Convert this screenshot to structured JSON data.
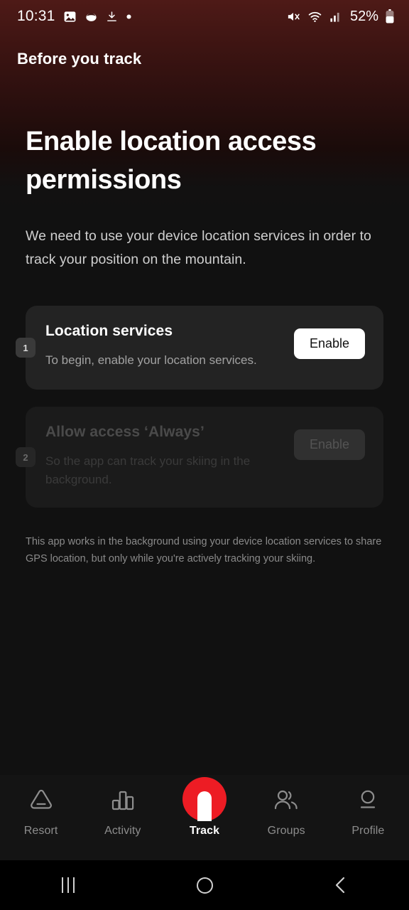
{
  "status_bar": {
    "time": "10:31",
    "battery_text": "52%",
    "icons": [
      "image-icon",
      "app-icon",
      "download-icon",
      "dot-icon",
      "mute-icon",
      "wifi-icon",
      "signal-icon",
      "battery-icon"
    ]
  },
  "top_bar": {
    "title": "Before you track"
  },
  "main": {
    "heading": "Enable location access permissions",
    "subtitle": "We need to use your device location services in order to track your position on the mountain.",
    "footnote": "This app works in the background using your device location services to share GPS location, but only while you're actively tracking your skiing.",
    "steps": [
      {
        "badge": "1",
        "title": "Location services",
        "description": "To begin, enable your location services.",
        "button_label": "Enable",
        "disabled": false
      },
      {
        "badge": "2",
        "title": "Allow access ‘Always’",
        "description": "So the app can track your skiing in the background.",
        "button_label": "Enable",
        "disabled": true
      }
    ]
  },
  "tab_bar": {
    "active_index": 2,
    "tabs": [
      {
        "label": "Resort",
        "icon": "mountain-icon"
      },
      {
        "label": "Activity",
        "icon": "bar-chart-icon"
      },
      {
        "label": "Track",
        "icon": "track-record-icon"
      },
      {
        "label": "Groups",
        "icon": "people-icon"
      },
      {
        "label": "Profile",
        "icon": "person-icon"
      }
    ]
  },
  "nav_bar": {
    "buttons": [
      "recents-icon",
      "home-icon",
      "back-icon"
    ]
  },
  "colors": {
    "accent_red": "#ed1c24",
    "background": "#111111",
    "card": "#232323",
    "header_gradient_top": "#4e1a17"
  }
}
